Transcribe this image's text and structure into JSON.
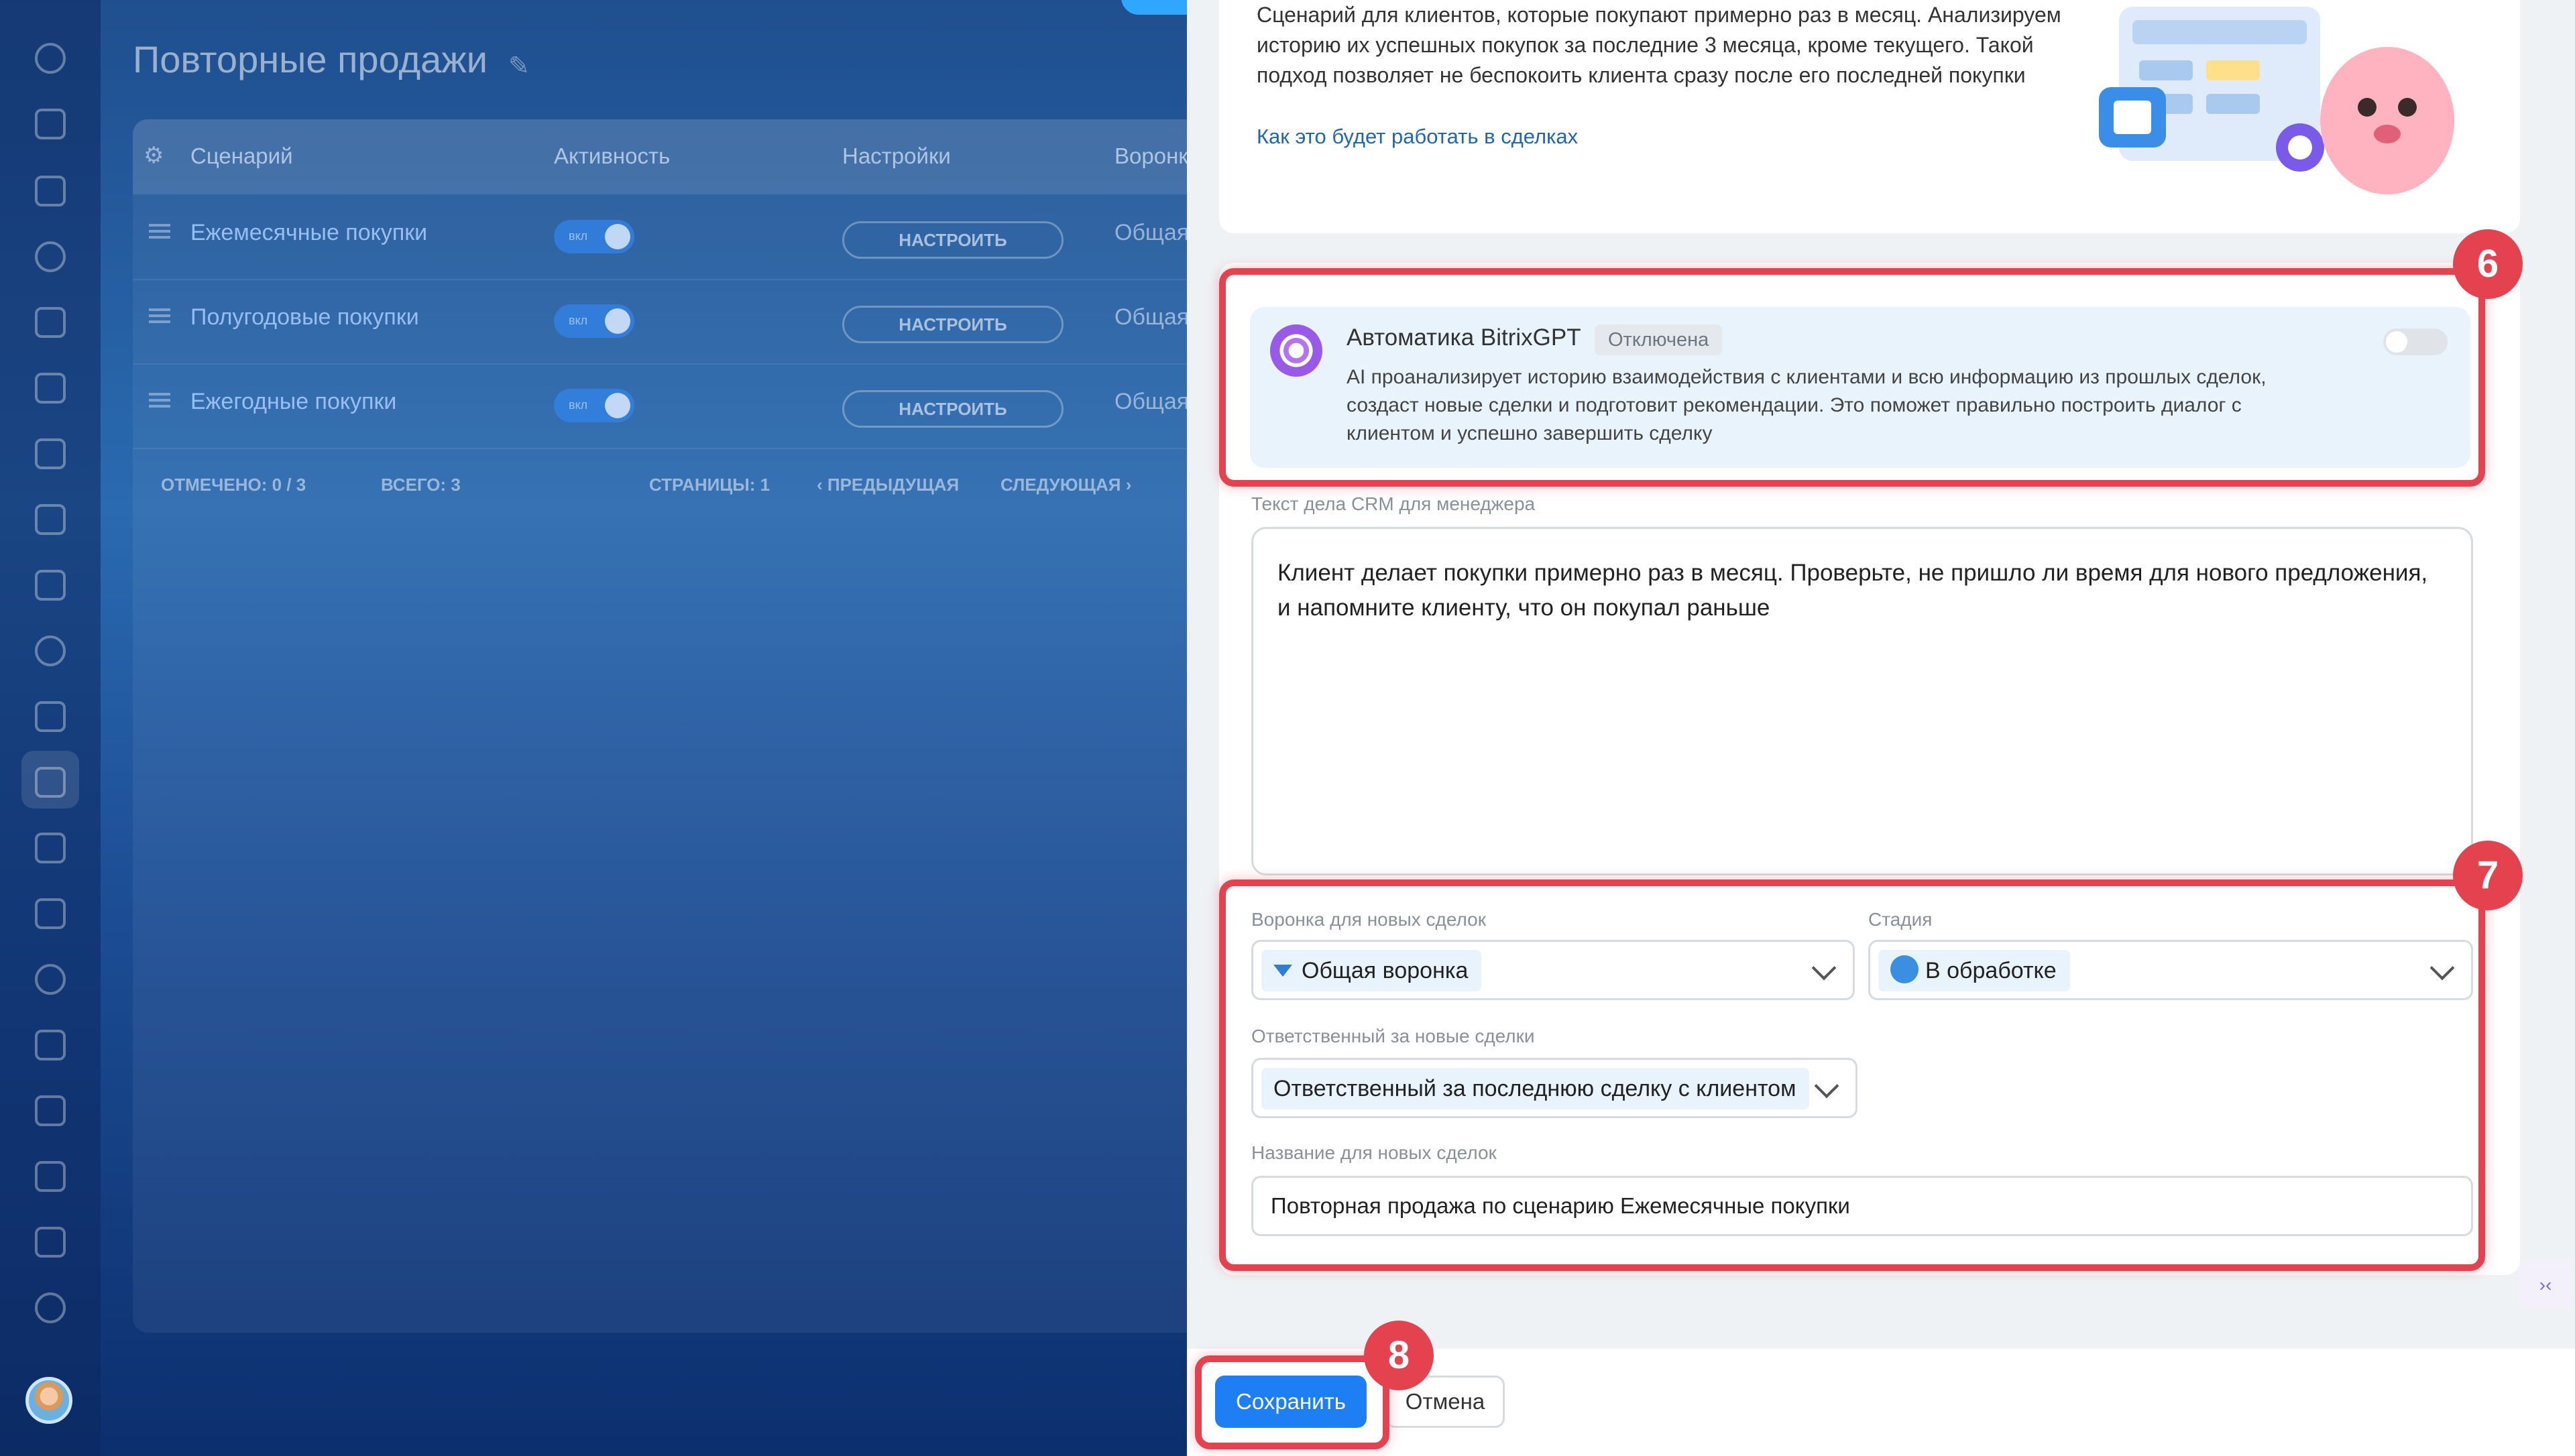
{
  "page": {
    "title": "Повторные продажи"
  },
  "table": {
    "headers": [
      "Сценарий",
      "Активность",
      "Настройки",
      "Воронк"
    ],
    "rows": [
      {
        "name": "Ежемесячные покупки",
        "toggle": "вкл",
        "settings": "НАСТРОИТЬ",
        "funnel": "Общая"
      },
      {
        "name": "Полугодовые покупки",
        "toggle": "вкл",
        "settings": "НАСТРОИТЬ",
        "funnel": "Общая"
      },
      {
        "name": "Ежегодные покупки",
        "toggle": "вкл",
        "settings": "НАСТРОИТЬ",
        "funnel": "Общая"
      }
    ],
    "footer": {
      "selected": "ОТМЕЧЕНО: 0 / 3",
      "total": "ВСЕГО: 3",
      "pages": "СТРАНИЦЫ:  1",
      "prev": "‹ ПРЕДЫДУЩАЯ",
      "next": "СЛЕДУЮЩАЯ ›"
    }
  },
  "scenario": {
    "description": "Сценарий для клиентов, которые покупают примерно раз в месяц. Анализируем историю их успешных покупок за последние 3 месяца, кроме текущего. Такой подход позволяет не беспокоить клиента сразу после его последней покупки",
    "link": "Как это будет работать в сделках"
  },
  "ai": {
    "title": "Автоматика BitrixGPT",
    "status": "Отключена",
    "text": "AI проанализирует историю взаимодействия с клиентами и всю информацию из прошлых сделок, создаст новые сделки и подготовит рекомендации. Это поможет правильно построить диалог с клиентом и успешно завершить сделку"
  },
  "form": {
    "crm_text_label": "Текст дела CRM для менеджера",
    "crm_text_value": "Клиент делает покупки примерно раз в месяц. Проверьте, не пришло ли время для нового предложения, и напомните клиенту, что он покупал раньше",
    "funnel_label": "Воронка для новых сделок",
    "funnel_value": "Общая воронка",
    "stage_label": "Стадия",
    "stage_value": "В обработке",
    "responsible_label": "Ответственный за новые сделки",
    "responsible_value": "Ответственный за последнюю сделку с клиентом",
    "deal_name_label": "Название для новых сделок",
    "deal_name_value": "Повторная продажа по сценарию Ежемесячные покупки"
  },
  "markers": [
    "6",
    "7",
    "8"
  ],
  "actions": {
    "save": "Сохранить",
    "cancel": "Отмена"
  },
  "colors": {
    "primary": "#1e7ff5",
    "highlight": "#e4424e",
    "link": "#2067b0"
  },
  "corner_widget": "›‹"
}
